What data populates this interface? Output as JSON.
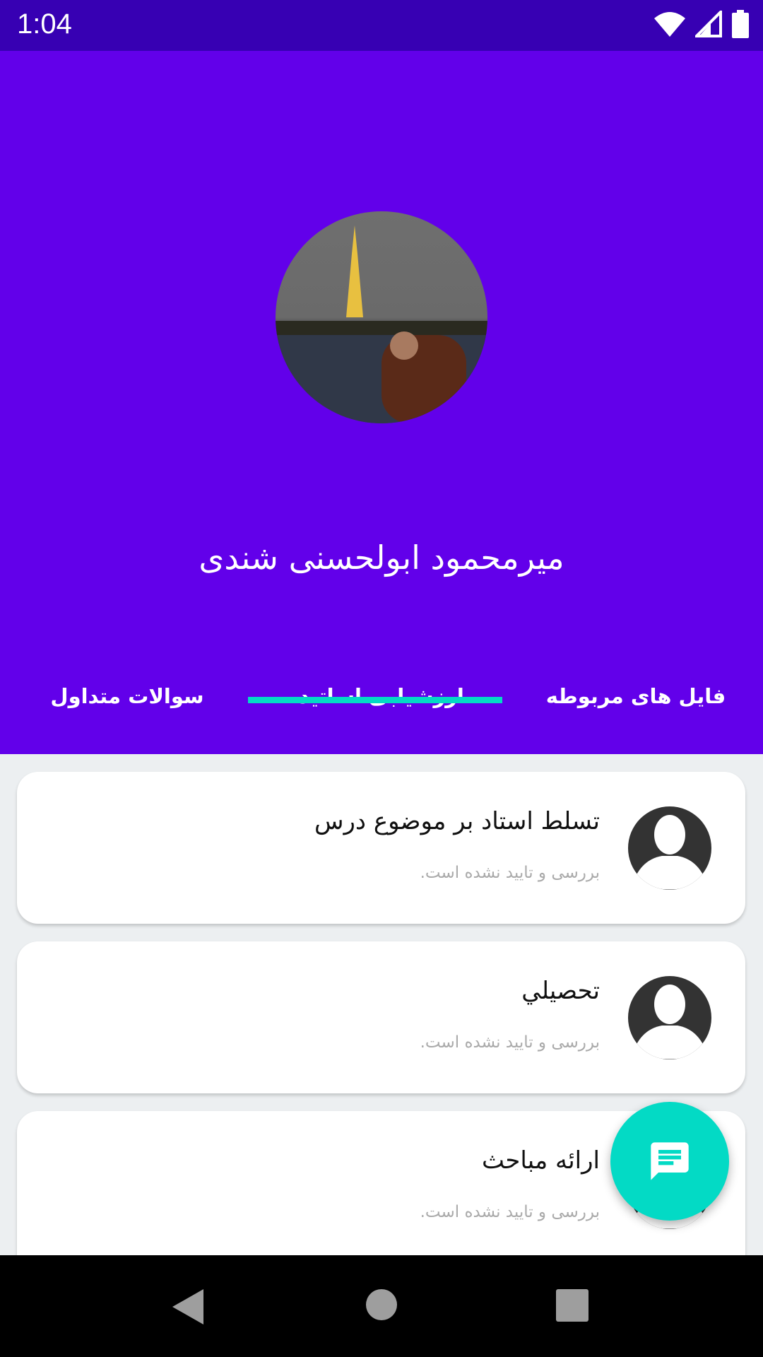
{
  "status_bar": {
    "time": "1:04"
  },
  "profile": {
    "name": "میرمحمود ابولحسنی شندی"
  },
  "tabs": [
    {
      "label": "فایل های مربوطه",
      "selected": false
    },
    {
      "label": "ارزشیابی اساتید",
      "selected": true
    },
    {
      "label": "سوالات متداول",
      "selected": false
    }
  ],
  "cards": [
    {
      "title": "تسلط استاد بر موضوع درس",
      "status": "بررسی و تایید نشده است."
    },
    {
      "title": "تحصيلي",
      "status": "بررسی و تایید نشده است."
    },
    {
      "title": "ارائه مباحث",
      "status": "بررسی و تایید نشده است."
    }
  ],
  "colors": {
    "status_bar": "#3700b3",
    "primary": "#6200ea",
    "accent": "#03dac5"
  }
}
